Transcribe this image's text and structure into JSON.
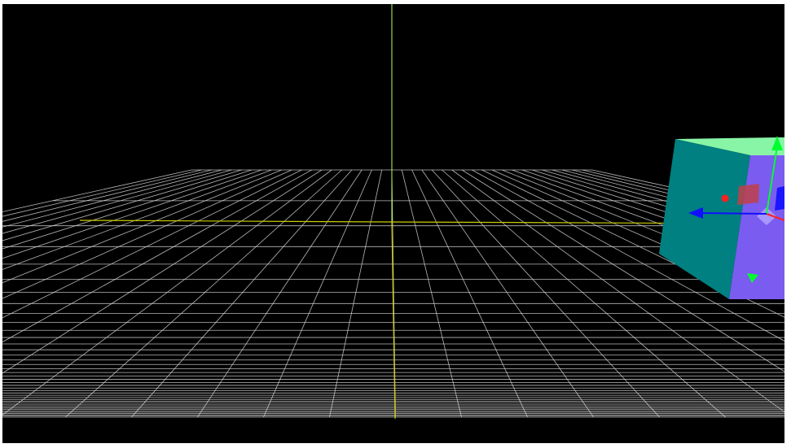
{
  "scene": {
    "background_color": "#000000",
    "grid_color": "#d8d8d8",
    "axis_x_color": "#cccc00",
    "axis_y_color": "#b6ff5a",
    "axis_z_color": "#cccc00",
    "object": {
      "type": "cube",
      "faces": {
        "top": "#88f5a6",
        "left": "#008080",
        "front": "#7b5cf0"
      },
      "selected": true
    },
    "gizmo": {
      "mode": "translate",
      "colors": {
        "x": "#ff2020",
        "y": "#00ff30",
        "z": "#1010ff",
        "plane_xy": "#c0404a",
        "plane_center": "#b4a6ff"
      }
    }
  }
}
